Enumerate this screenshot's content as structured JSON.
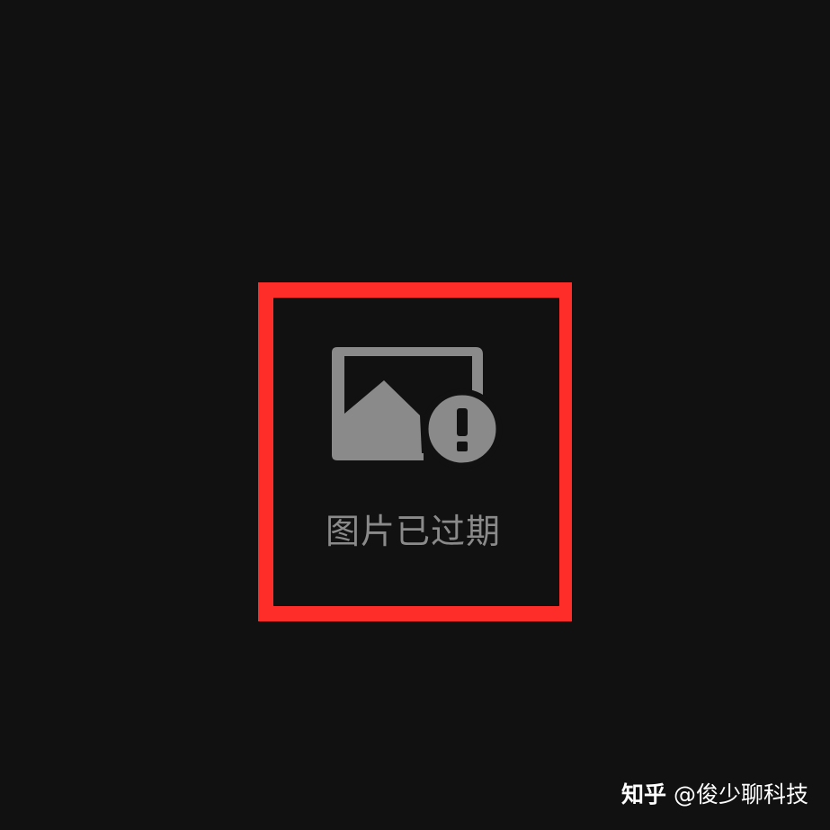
{
  "placeholder": {
    "status_text": "图片已过期",
    "icon": "expired-image-icon",
    "text_color": "#8a8a8a",
    "icon_color": "#8a8a8a"
  },
  "annotation": {
    "highlight_color": "#ff2d29"
  },
  "watermark": {
    "platform": "知乎",
    "author": "@俊少聊科技"
  },
  "background_color": "#111111"
}
